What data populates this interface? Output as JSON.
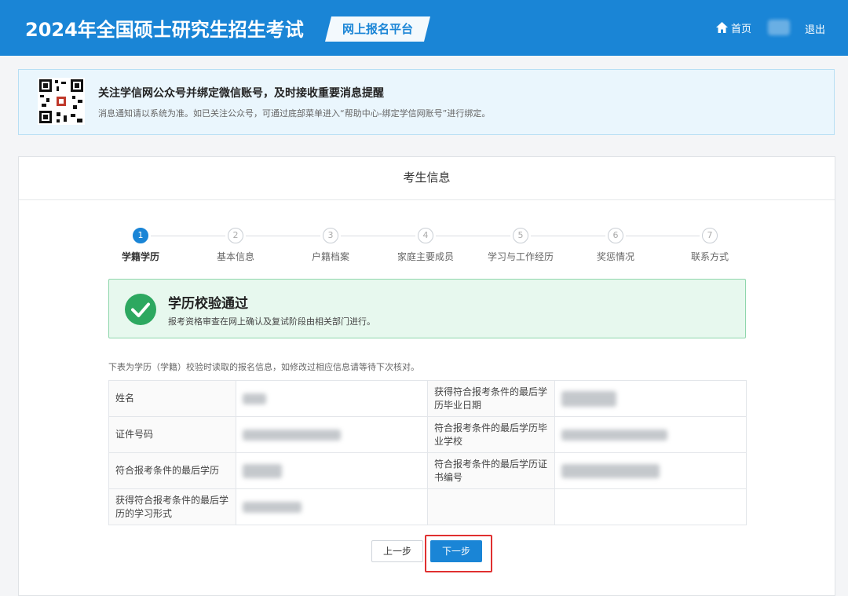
{
  "header": {
    "title": "2024年全国硕士研究生招生考试",
    "platform": "网上报名平台",
    "home": "首页",
    "logout": "退出"
  },
  "notice": {
    "title": "关注学信网公众号并绑定微信账号，及时接收重要消息提醒",
    "text": "消息通知请以系统为准。如已关注公众号，可通过底部菜单进入“帮助中心-绑定学信网账号”进行绑定。"
  },
  "card": {
    "title": "考生信息"
  },
  "steps": [
    {
      "num": "1",
      "label": "学籍学历"
    },
    {
      "num": "2",
      "label": "基本信息"
    },
    {
      "num": "3",
      "label": "户籍档案"
    },
    {
      "num": "4",
      "label": "家庭主要成员"
    },
    {
      "num": "5",
      "label": "学习与工作经历"
    },
    {
      "num": "6",
      "label": "奖惩情况"
    },
    {
      "num": "7",
      "label": "联系方式"
    }
  ],
  "active_step": 1,
  "success": {
    "title": "学历校验通过",
    "text": "报考资格审查在网上确认及复试阶段由相关部门进行。"
  },
  "table": {
    "note": "下表为学历（学籍）校验时读取的报名信息，如修改过相应信息请等待下次核对。",
    "rows": [
      {
        "l1": "姓名",
        "l2": "获得符合报考条件的最后学历毕业日期"
      },
      {
        "l1": "证件号码",
        "l2": "符合报考条件的最后学历毕业学校"
      },
      {
        "l1": "符合报考条件的最后学历",
        "l2": "符合报考条件的最后学历证书编号"
      },
      {
        "l1": "获得符合报考条件的最后学历的学习形式",
        "l2": ""
      }
    ]
  },
  "buttons": {
    "prev": "上一步",
    "next": "下一步"
  },
  "colors": {
    "primary": "#1a85d6",
    "success": "#2da860",
    "highlight": "#e03030"
  }
}
